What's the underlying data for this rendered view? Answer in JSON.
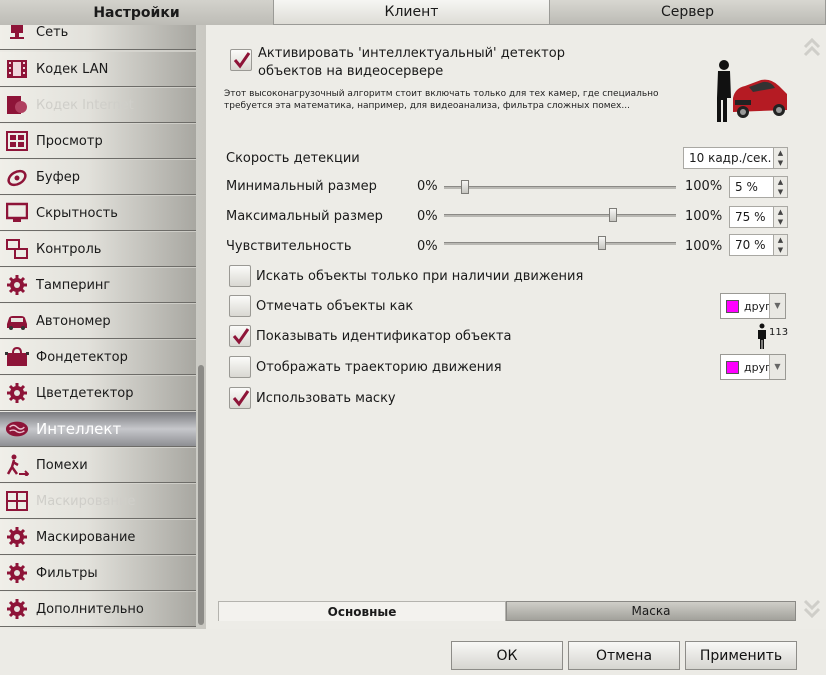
{
  "top_tabs": [
    "Настройки",
    "Клиент",
    "Сервер"
  ],
  "sidebar": {
    "items": [
      {
        "label": "Сеть",
        "icon": "network-icon",
        "dim": false
      },
      {
        "label": "Кодек LAN",
        "icon": "codec-icon",
        "dim": false
      },
      {
        "label": "Кодек Internet",
        "icon": "codec-internet-icon",
        "dim": true
      },
      {
        "label": "Просмотр",
        "icon": "view-icon",
        "dim": false
      },
      {
        "label": "Буфер",
        "icon": "buffer-icon",
        "dim": false
      },
      {
        "label": "Скрытность",
        "icon": "monitor-icon",
        "dim": false
      },
      {
        "label": "Контроль",
        "icon": "control-icon",
        "dim": false
      },
      {
        "label": "Тамперинг",
        "icon": "gear-icon",
        "dim": false
      },
      {
        "label": "Автономер",
        "icon": "car-icon",
        "dim": false
      },
      {
        "label": "Фондетектор",
        "icon": "bag-icon",
        "dim": false
      },
      {
        "label": "Цветдетектор",
        "icon": "gear-icon",
        "dim": false
      },
      {
        "label": "Интеллект",
        "icon": "brain-icon",
        "dim": false,
        "active": true
      },
      {
        "label": "Помехи",
        "icon": "walker-icon",
        "dim": false
      },
      {
        "label": "Маскирование",
        "icon": "mask-region-icon",
        "dim": true
      },
      {
        "label": "Маскирование",
        "icon": "gear-icon",
        "dim": false
      },
      {
        "label": "Фильтры",
        "icon": "gear-icon",
        "dim": false
      },
      {
        "label": "Дополнительно",
        "icon": "gear-icon",
        "dim": false
      }
    ]
  },
  "main": {
    "activate_label_1": "Активировать 'интеллектуальный' детектор",
    "activate_label_2": "объектов на видеосервере",
    "activate_checked": true,
    "description_1": "Этот высоконагрузочный алгоритм стоит включать только для тех камер, где специально",
    "description_2": "требуется эта математика, например, для видеоанализа, фильтра сложных помех...",
    "speed_label": "Скорость детекции",
    "speed_value": "10 кадр./сек.",
    "sliders": [
      {
        "label": "Минимальный размер",
        "min": "0%",
        "max": "100%",
        "value": "5 %",
        "level": 0.05
      },
      {
        "label": "Максимальный размер",
        "min": "0%",
        "max": "100%",
        "value": "75 %",
        "level": 0.75
      },
      {
        "label": "Чувствительность",
        "min": "0%",
        "max": "100%",
        "value": "70 %",
        "level": 0.7
      }
    ],
    "options": [
      {
        "label": "Искать объекты только при наличии движения",
        "checked": false
      },
      {
        "label": "Отмечать объекты как",
        "checked": false
      },
      {
        "label": "Показывать идентификатор объекта",
        "checked": true
      },
      {
        "label": "Отображать траекторию движения",
        "checked": false
      },
      {
        "label": "Использовать маску",
        "checked": true
      }
    ],
    "mark_combo": "друг",
    "trail_combo": "друг",
    "id_sample": "113",
    "accent_color": "#ff00ff",
    "bottom_tabs": [
      "Основные",
      "Маска"
    ]
  },
  "buttons": {
    "ok": "ОК",
    "cancel": "Отмена",
    "apply": "Применить"
  }
}
